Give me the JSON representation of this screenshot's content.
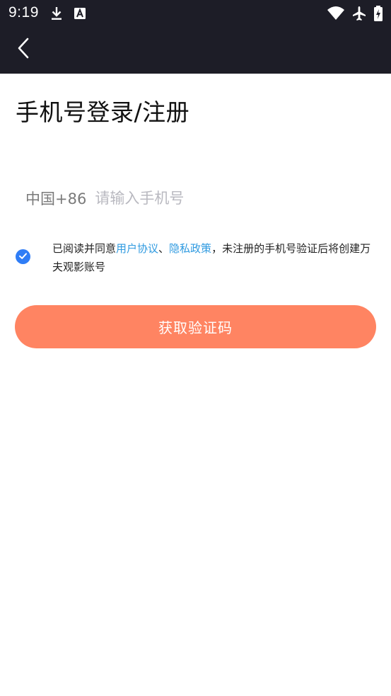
{
  "status_bar": {
    "time": "9:19",
    "icons": [
      "download-icon",
      "a11y-a-icon",
      "wifi-icon",
      "airplane-mode-icon",
      "battery-charging-icon"
    ]
  },
  "app_bar": {
    "back_icon": "chevron-left-icon"
  },
  "page": {
    "title": "手机号登录/注册"
  },
  "phone": {
    "country_code": "中国+86",
    "placeholder": "请输入手机号",
    "value": ""
  },
  "agreement": {
    "checked": true,
    "prefix": "已阅读并同意",
    "user_agreement": "用户协议",
    "separator": "、",
    "privacy_policy": "隐私政策",
    "suffix": "，未注册的手机号验证后将创建万夫观影账号"
  },
  "cta": {
    "label": "获取验证码"
  },
  "colors": {
    "status_bar_bg": "#1d1d27",
    "app_bar_bg": "#1d1d27",
    "accent_button": "#ff8462",
    "checkbox": "#2f7df6",
    "link": "#2f9ae0"
  }
}
